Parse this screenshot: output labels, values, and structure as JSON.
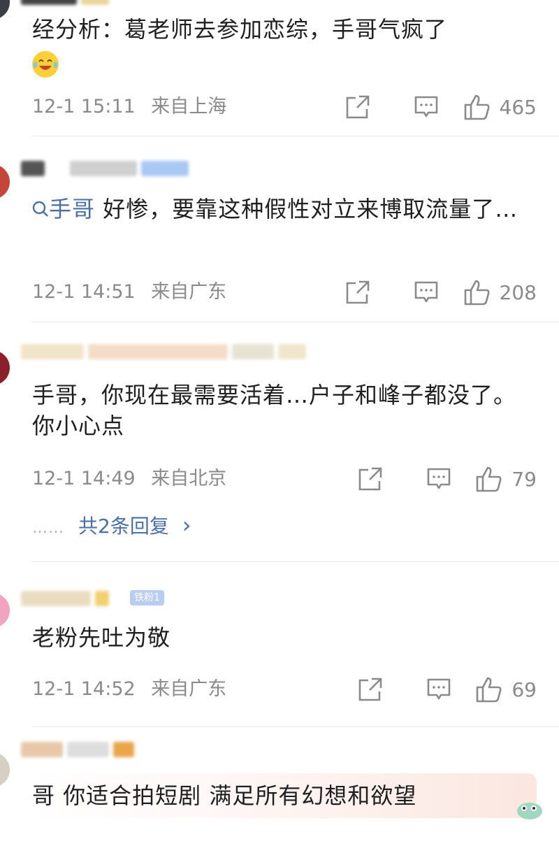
{
  "comments": [
    {
      "text": "经分析：葛老师去参加恋综，手哥气疯了",
      "time": "12-1 15:11",
      "location": "来自上海",
      "likes": "465"
    },
    {
      "topic": "手哥",
      "text": " 好惨，要靠这种假性对立来博取流量了…",
      "time": "12-1 14:51",
      "location": "来自广东",
      "likes": "208"
    },
    {
      "text": "手哥，你现在最需要活着…户子和峰子都没了。你小心点",
      "time": "12-1 14:49",
      "location": "来自北京",
      "likes": "79",
      "replies": {
        "dots": "……",
        "label": "共2条回复",
        "chevron": "›"
      }
    },
    {
      "badge": "铁粉1",
      "text": "老粉先吐为敬",
      "time": "12-1 14:52",
      "location": "来自广东",
      "likes": "69"
    },
    {
      "text": "哥 你适合拍短剧 满足所有幻想和欲望"
    }
  ],
  "icons": {
    "share": "share-icon",
    "comment": "comment-icon",
    "like": "thumbs-up-icon",
    "search": "search-icon",
    "chevron": "chevron-right-icon"
  },
  "colors": {
    "link": "#4a6fa5",
    "meta": "#8a8a8a",
    "text": "#1f1f1f",
    "divider": "#e9e9e9"
  }
}
